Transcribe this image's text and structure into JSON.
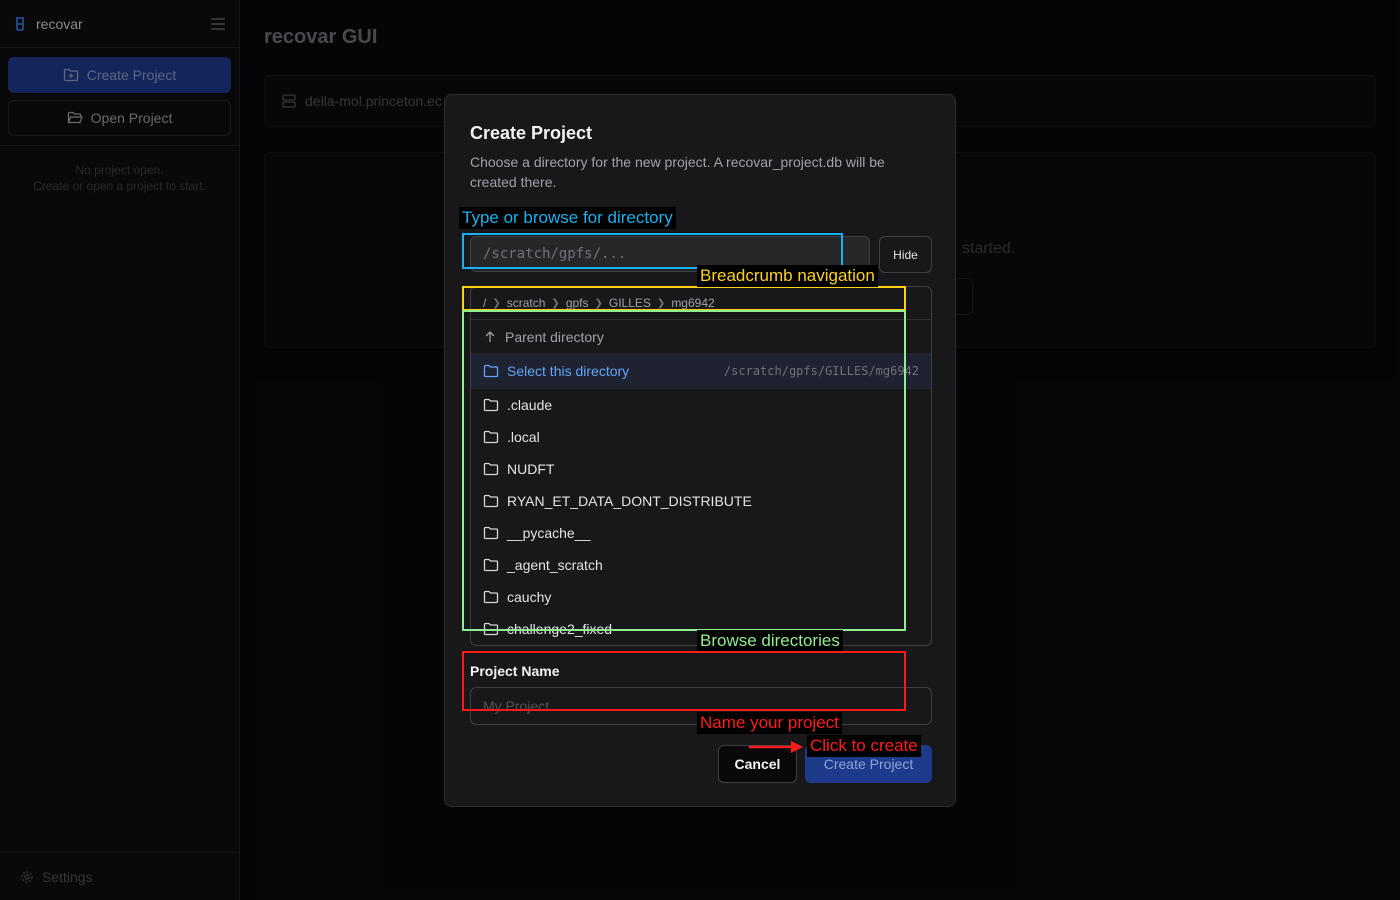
{
  "sidebar": {
    "app_name": "recovar",
    "create_project_label": "Create Project",
    "open_project_label": "Open Project",
    "empty_line1": "No project open.",
    "empty_line2": "Create or open a project to start.",
    "settings_label": "Settings"
  },
  "main": {
    "title": "recovar GUI",
    "host": "della-mol.princeton.ec",
    "started_text": "started."
  },
  "dialog": {
    "title": "Create Project",
    "description": "Choose a directory for the new project. A recovar_project.db will be created there.",
    "path_placeholder": "/scratch/gpfs/...",
    "hide_label": "Hide",
    "breadcrumbs": [
      "/",
      "scratch",
      "gpfs",
      "GILLES",
      "mg6942"
    ],
    "parent_label": "Parent directory",
    "select_label": "Select this directory",
    "select_path": "/scratch/gpfs/GILLES/mg6942",
    "directories": [
      ".claude",
      ".local",
      "NUDFT",
      "RYAN_ET_DATA_DONT_DISTRIBUTE",
      "__pycache__",
      "_agent_scratch",
      "cauchy",
      "challenge2_fixed"
    ],
    "project_name_label": "Project Name",
    "project_name_placeholder": "My Project",
    "cancel_label": "Cancel",
    "create_label": "Create Project"
  },
  "annotations": {
    "path_box": {
      "label": "Type or browse for directory",
      "color": "#1ab0f0"
    },
    "breadcrumb_box": {
      "label": "Breadcrumb navigation",
      "color": "#ffd21a"
    },
    "browse_box": {
      "label": "Browse directories",
      "color": "#90ee90"
    },
    "name_box": {
      "label": "Name your project",
      "color": "#ff1a1a"
    },
    "create_arrow": {
      "label": "Click to create",
      "color": "#ff1a1a"
    }
  },
  "icons": {
    "logo": "beaker-icon",
    "menu": "hamburger-icon",
    "folder": "folder-icon",
    "folder_plus": "folder-plus-icon",
    "folder_open": "folder-open-icon",
    "server": "server-icon",
    "settings": "gear-icon",
    "up": "arrow-up-icon"
  }
}
